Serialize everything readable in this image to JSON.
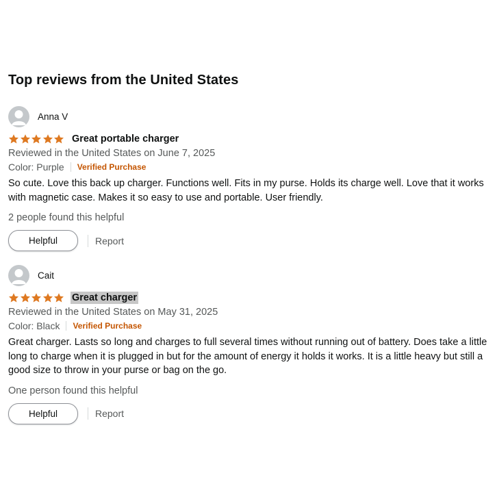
{
  "section_title": "Top reviews from the United States",
  "colors": {
    "star": "#de7921",
    "verified": "#c45500",
    "secondary_text": "#565959",
    "avatar_bg": "#c4c8cb"
  },
  "reviews": [
    {
      "reviewer": "Anna V",
      "rating": 5,
      "max_rating": 5,
      "title": "Great portable charger",
      "title_highlighted": false,
      "date_line": "Reviewed in the United States on June 7, 2025",
      "color_variant": "Color: Purple",
      "verified_label": "Verified Purchase",
      "body": "So cute. Love this back up charger. Functions well. Fits in my purse. Holds its charge well. Love that it works with magnetic case. Makes it so easy to use and portable. User friendly.",
      "helpful_count_text": "2 people found this helpful",
      "helpful_button": "Helpful",
      "report_link": "Report"
    },
    {
      "reviewer": "Cait",
      "rating": 5,
      "max_rating": 5,
      "title": "Great charger",
      "title_highlighted": true,
      "date_line": "Reviewed in the United States on May 31, 2025",
      "color_variant": "Color: Black",
      "verified_label": "Verified Purchase",
      "body": "Great charger. Lasts so long and charges to full several times without running out of battery. Does take a little long to charge when it is plugged in but for the amount of energy it holds it works. It is a little heavy but still a good size to throw in your purse or bag on the go.",
      "helpful_count_text": "One person found this helpful",
      "helpful_button": "Helpful",
      "report_link": "Report"
    }
  ]
}
